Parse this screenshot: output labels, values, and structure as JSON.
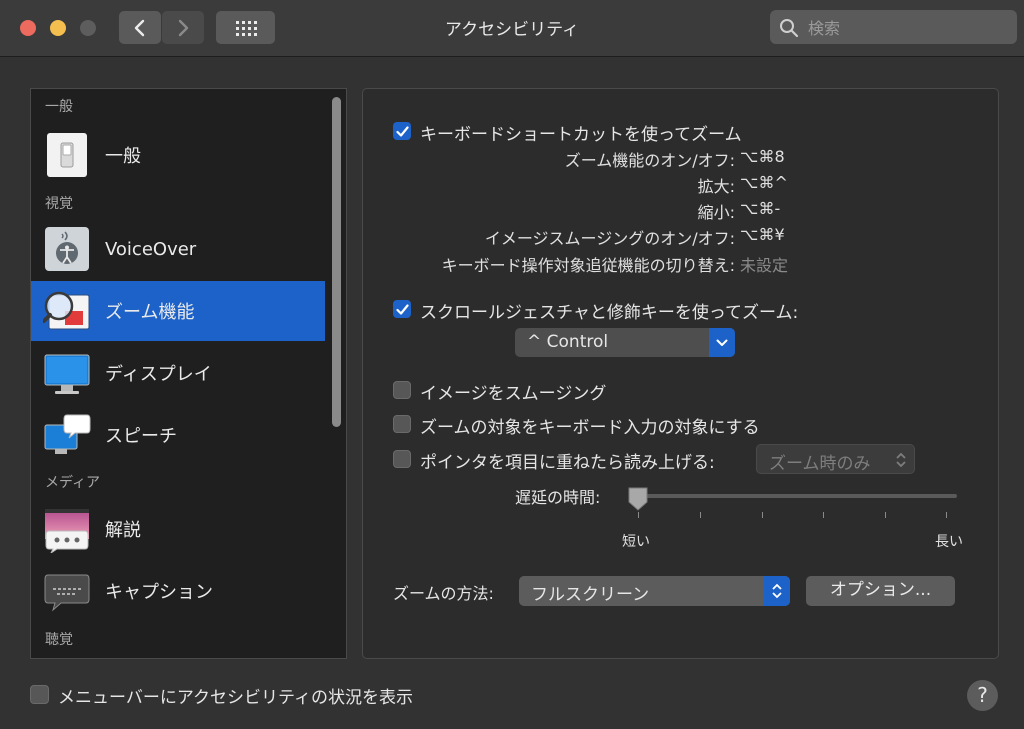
{
  "window": {
    "title": "アクセシビリティ",
    "search_placeholder": "検索"
  },
  "sidebar": {
    "sections": [
      {
        "header": "一般"
      },
      {
        "header": "視覚"
      },
      {
        "header": "メディア"
      },
      {
        "header": "聴覚"
      }
    ],
    "items": [
      {
        "label": "一般",
        "icon": "general-switch-icon"
      },
      {
        "label": "VoiceOver",
        "icon": "voiceover-icon"
      },
      {
        "label": "ズーム機能",
        "icon": "zoom-icon",
        "selected": true
      },
      {
        "label": "ディスプレイ",
        "icon": "display-icon"
      },
      {
        "label": "スピーチ",
        "icon": "speech-icon"
      },
      {
        "label": "解説",
        "icon": "descriptions-icon"
      },
      {
        "label": "キャプション",
        "icon": "captions-icon"
      }
    ]
  },
  "zoom": {
    "keyboard_shortcuts": {
      "label": "キーボードショートカットを使ってズーム",
      "checked": true,
      "rows": [
        {
          "label": "ズーム機能のオン/オフ:",
          "value": "⌥⌘8"
        },
        {
          "label": "拡大:",
          "value": "⌥⌘^"
        },
        {
          "label": "縮小:",
          "value": "⌥⌘-"
        },
        {
          "label": "イメージスムージングのオン/オフ:",
          "value": "⌥⌘¥"
        },
        {
          "label": "キーボード操作対象追従機能の切り替え:",
          "value": "未設定"
        }
      ]
    },
    "scroll_gesture": {
      "label": "スクロールジェスチャと修飾キーを使ってズーム:",
      "checked": true,
      "modifier_value": "^ Control"
    },
    "smooth_images": {
      "label": "イメージをスムージング",
      "checked": false
    },
    "follow_keyboard": {
      "label": "ズームの対象をキーボード入力の対象にする",
      "checked": false
    },
    "hover_speak": {
      "label": "ポインタを項目に重ねたら読み上げる:",
      "checked": false,
      "mode_value": "ズーム時のみ"
    },
    "delay": {
      "label": "遅延の時間:",
      "min_label": "短い",
      "max_label": "長い",
      "value": 0
    },
    "zoom_style": {
      "label": "ズームの方法:",
      "value": "フルスクリーン",
      "options_button": "オプション..."
    }
  },
  "footer": {
    "show_status_label": "メニューバーにアクセシビリティの状況を表示",
    "show_status_checked": false,
    "help_label": "?"
  },
  "colors": {
    "accent": "#1d62c9",
    "window_bg": "#323232",
    "sidebar_bg": "#1f1f1f"
  }
}
